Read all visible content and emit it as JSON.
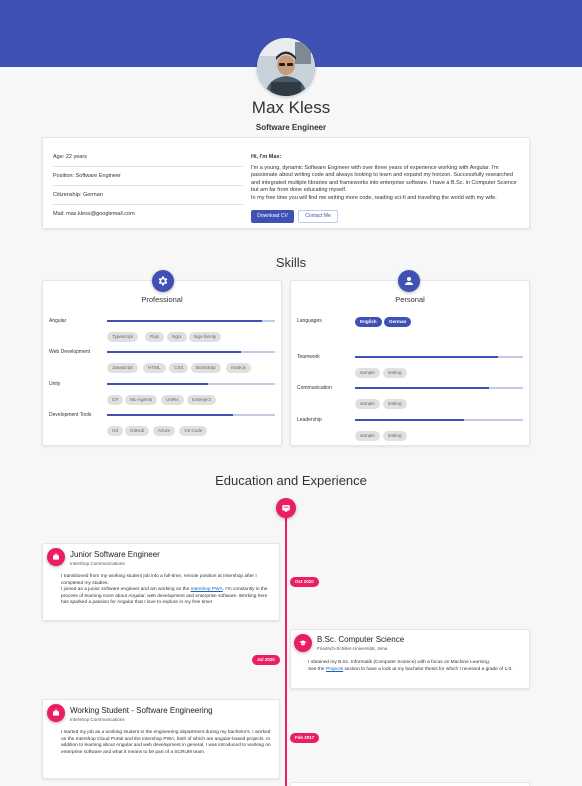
{
  "profile": {
    "name": "Max Kless",
    "role": "Software Engineer"
  },
  "info": {
    "age": "Age: 22 years",
    "position": "Position: Software Engineer",
    "citizenship": "Citizenship: German",
    "mail": "Mail: max.kless@googlemail.com"
  },
  "about": {
    "title": "Hi, I'm Max:",
    "p1": "I'm a young, dynamic Software Engineer with over three years of experience working with Angular. I'm passionate about writing code and always looking to learn and expand my horizon. Successfully researched and integrated multiple libraries and frameworks into enterprise software. I have a B.Sc. in Computer Science but am far from done educating myself.",
    "p2": "In my free time you will find me writing more code, reading sci-fi and travelling the world with my wife.",
    "download_label": "Download CV",
    "contact_label": "Contact Me"
  },
  "skills": {
    "title": "Skills",
    "professional": {
      "heading": "Professional",
      "icon": "gear-icon",
      "items": [
        {
          "label": "Angular",
          "level": 0.92,
          "chips": [
            "Typescript",
            "Rxjs",
            "Ngrx",
            "Ngx-formly"
          ]
        },
        {
          "label": "Web Development",
          "level": 0.8,
          "chips": [
            "Javascript",
            "HTML",
            "CSS",
            "Bootstrap",
            "node.js"
          ]
        },
        {
          "label": "Unity",
          "level": 0.6,
          "chips": [
            "C#",
            "ML-Agents",
            "UniRx",
            "Extenject"
          ]
        },
        {
          "label": "Development Tools",
          "level": 0.75,
          "chips": [
            "Git",
            "GitHub",
            "Azure",
            "VS Code"
          ]
        }
      ]
    },
    "personal": {
      "heading": "Personal",
      "icon": "person-icon",
      "languages_label": "Languages",
      "languages": [
        "English",
        "German"
      ],
      "items": [
        {
          "label": "Teamwork",
          "level": 0.85,
          "chips": [
            "sample",
            "testing"
          ]
        },
        {
          "label": "Communication",
          "level": 0.8,
          "chips": [
            "sample",
            "testing"
          ]
        },
        {
          "label": "Leadership",
          "level": 0.65,
          "chips": [
            "sample",
            "testing"
          ]
        }
      ]
    }
  },
  "education": {
    "title": "Education and Experience",
    "top_icon": "card-icon",
    "entries": [
      {
        "title": "Junior Software Engineer",
        "org": "Intershop Communications",
        "date": "Oct 2020",
        "icon": "briefcase-icon",
        "body_a": "I transitioned from my working student job into a full-time, remote position at Intershop after I completed my studies.",
        "body_b_pre": "I joined as a junior software engineer and am working on the ",
        "body_b_link": "Intershop PWA",
        "body_b_post": ". I'm constantly in the process of learning more about Angular, web development and enterprise software. Working here has sparked a passion for Angular that I love to explore in my free time!"
      },
      {
        "title": "B.Sc. Computer Science",
        "org": "Friedrich-Schiller-Universität, Jena",
        "date": "Jul 2020",
        "icon": "graduation-cap-icon",
        "body_a": "I obtained my B.Sc. Informatik (Computer Science) with a focus on Machine Learning.",
        "body_b_pre": "See the ",
        "body_b_link": "Projects",
        "body_b_post": " section to have a look at my bachelor thesis for which I received a grade of 1,0."
      },
      {
        "title": "Working Student - Software Engineering",
        "org": "Intershop Communications",
        "date": "Feb 2017",
        "icon": "briefcase-icon",
        "body_a": "I started my job as a working student in the engineering department during my bachelor's. I worked on the Intershop Cloud Portal and the Intershop PWA, both of which are angular-based projects. In addition to learning about Angular and web development in general, I was introduced to working on enterprise software and what it means to be part of a SCRUM team."
      }
    ]
  },
  "colors": {
    "primary": "#3f51b5",
    "accent": "#e91e63",
    "track": "#c5cae9",
    "chip": "#e0e0e0"
  }
}
